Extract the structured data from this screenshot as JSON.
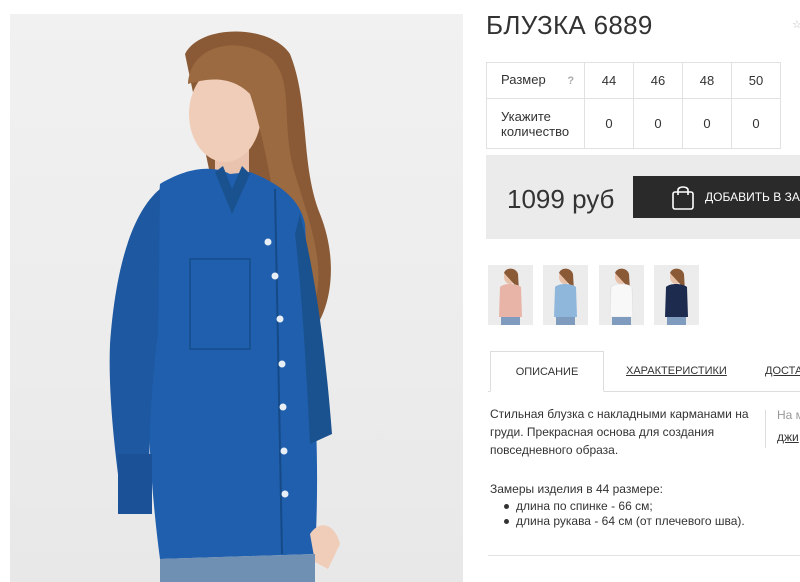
{
  "product": {
    "title": "БЛУЗКА 6889",
    "price": "1099 руб",
    "add_to_cart_label": "ДОБАВИТЬ В ЗАКАЗ"
  },
  "size_table": {
    "size_label": "Размер",
    "help_symbol": "?",
    "qty_label": "Укажите количество",
    "sizes": [
      "44",
      "46",
      "48",
      "50"
    ],
    "quantities": [
      "0",
      "0",
      "0",
      "0"
    ]
  },
  "thumbnails": [
    {
      "color_name": "pink",
      "color": "#e9b4a8"
    },
    {
      "color_name": "light-blue",
      "color": "#8fb7dc"
    },
    {
      "color_name": "white",
      "color": "#f3f3f3"
    },
    {
      "color_name": "navy",
      "color": "#1d2b4f"
    }
  ],
  "tabs": [
    {
      "label": "ОПИСАНИЕ",
      "active": true
    },
    {
      "label": "ХАРАКТЕРИСТИКИ",
      "active": false
    },
    {
      "label": "ДОСТА",
      "active": false
    }
  ],
  "description": {
    "text": "Стильная блузка с накладными карманами на груди. Прекрасная основа для создания повседневного образа.",
    "measures_title": "Замеры изделия в 44 размере:",
    "measures": [
      "длина по спинке - 66 см;",
      "длина рукава - 64 см (от плечевого шва)."
    ]
  },
  "side_info": {
    "muted_text": "На м",
    "link_text": "джи"
  },
  "colors": {
    "blouse": "#1f5fae",
    "dark_button": "#2a2a2a",
    "price_bg": "#ebebeb"
  }
}
